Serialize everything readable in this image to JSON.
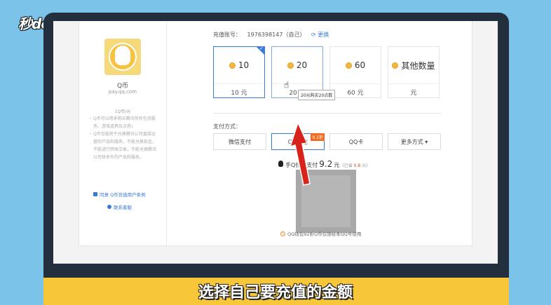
{
  "watermark": {
    "brand": "秒dong视频"
  },
  "product": {
    "name": "Q币",
    "url": "pay.qq.com",
    "rate": "1Q币/元",
    "notes": [
      "Q币可以用来购买腾讯所有包月服务、游戏道具及点券；",
      "Q币仅能用于兑换腾讯公司直接运营的产品和服务，不能兑换现金，不能进行转账交易，不能兑换腾讯公司体系外的产品和服务。"
    ],
    "agree_label": "同意 Q币充值用户条例",
    "support_label": "联系客服"
  },
  "account": {
    "label": "充值账号：",
    "value": "1976398147（自己）",
    "switch_label": "更换"
  },
  "amounts": [
    {
      "count": "10",
      "price": "10 元",
      "state": "selected"
    },
    {
      "count": "20",
      "price": "20 元",
      "state": "hovered"
    },
    {
      "count": "60",
      "price": "60 元",
      "state": "normal"
    },
    {
      "count": "其他数量",
      "price": "元",
      "state": "normal"
    }
  ],
  "tooltip": "20元购买20点数",
  "payment": {
    "label": "支付方式：",
    "methods": [
      {
        "label": "微信支付",
        "active": false,
        "badge": ""
      },
      {
        "label": "QQ钱包",
        "active": true,
        "badge": "9.2折"
      },
      {
        "label": "QQ卡",
        "active": false,
        "badge": ""
      },
      {
        "label": "更多方式 ▾",
        "active": false,
        "badge": ""
      }
    ]
  },
  "scan": {
    "prefix": "手Q扫码",
    "middle": "支付",
    "price": "9.2",
    "unit": "元",
    "saved_prefix": "(已省",
    "saved_amount": "0.8",
    "saved_suffix": "元)"
  },
  "qr_note": "QQ钱包92折Q币仅限给本QQ号使用",
  "subtitle": "选择自己要充值的金额",
  "colors": {
    "background": "#7cc3ea",
    "monitor": "#232f3d",
    "accent_blue": "#3a7bd5",
    "badge_orange": "#f26b21",
    "arrow_red": "#d8221c",
    "subtitle_bar": "#f8c739"
  }
}
